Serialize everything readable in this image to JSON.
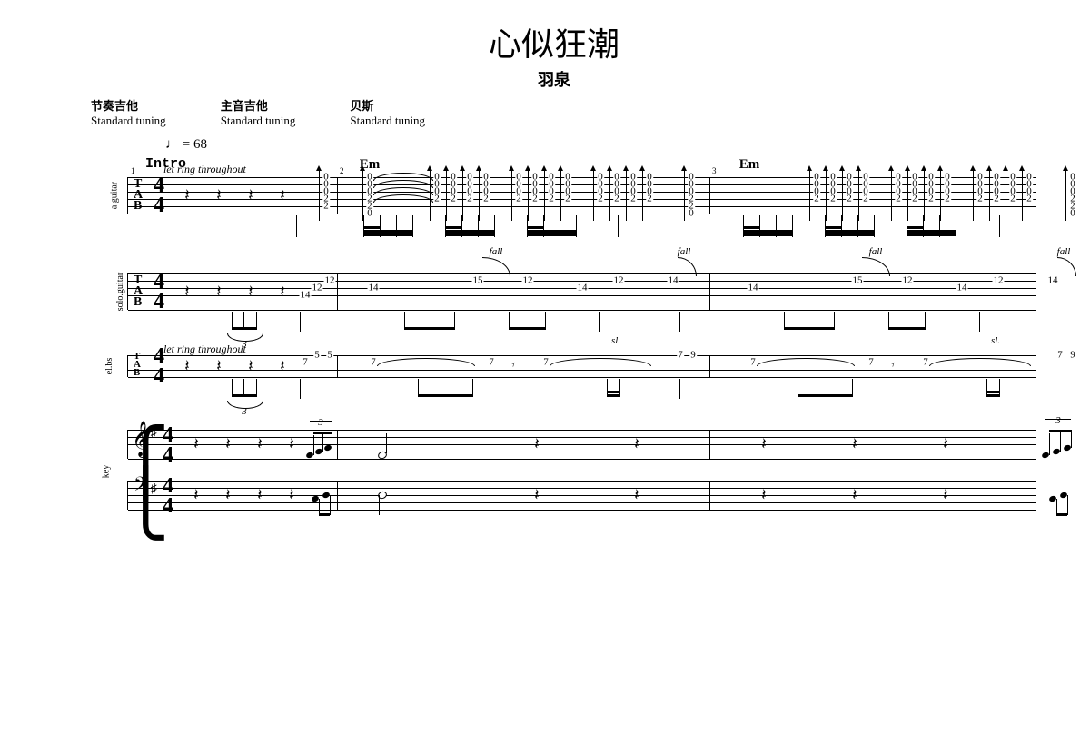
{
  "title": "心似狂潮",
  "artist": "羽泉",
  "instruments": [
    {
      "cn": "节奏吉他",
      "en": "Standard tuning"
    },
    {
      "cn": "主音吉他",
      "en": "Standard tuning"
    },
    {
      "cn": "贝斯",
      "en": "Standard tuning"
    }
  ],
  "tempo_note": "♩",
  "tempo_text": " = 68",
  "section": "Intro",
  "time_signature": {
    "num": "4",
    "den": "4"
  },
  "directions": {
    "let_ring": "let ring throughout",
    "fall": "fall",
    "slide": "sl."
  },
  "chords": {
    "Em": "Em"
  },
  "staff_labels": {
    "rhythm_guitar": "a.guitar",
    "solo_guitar": "solo.guitar",
    "bass": "el.bs",
    "keys": "key"
  },
  "tab_clef": [
    "T",
    "A",
    "B"
  ],
  "bar_numbers": [
    "1",
    "2",
    "3"
  ],
  "tuplet": "3",
  "chart_data": {
    "type": "guitar_tablature_score",
    "tempo_bpm": 68,
    "time_signature": "4/4",
    "key_signature": "G major / E minor (one sharp)",
    "measures_shown": 3,
    "tracks": [
      {
        "name": "a.guitar (rhythm)",
        "tuning": "Standard",
        "direction": "let ring throughout",
        "bars": [
          {
            "bar": 1,
            "events": [
              {
                "type": "rest",
                "dur": "q",
                "count": 4
              },
              {
                "type": "pickup",
                "notes": [
                  {
                    "string": 4,
                    "fret": 2
                  },
                  {
                    "string": 3,
                    "fret": 2
                  },
                  {
                    "string": 2,
                    "fret": 0
                  },
                  {
                    "string": 1,
                    "fret": 0
                  }
                ]
              }
            ]
          },
          {
            "bar": 2,
            "chord": "Em",
            "events": [
              {
                "type": "strum",
                "dir": "down",
                "beat": 1,
                "frets": [
                  0,
                  0,
                  0,
                  2,
                  2,
                  0
                ],
                "tied_to_next": true
              },
              {
                "type": "strum_group",
                "pattern": "dudu dudu dudu",
                "frets": [
                  0,
                  0,
                  0,
                  2,
                  "",
                  ""
                ]
              },
              {
                "type": "strum",
                "dir": "up",
                "beat": 4.75,
                "frets": [
                  0,
                  0,
                  0,
                  2,
                  2,
                  0
                ]
              }
            ]
          },
          {
            "bar": 3,
            "chord": "Em",
            "events": [
              {
                "type": "strum",
                "dir": "down",
                "beat": 1,
                "frets": [
                  0,
                  0,
                  0,
                  2,
                  2,
                  0
                ]
              },
              {
                "type": "strum_group",
                "pattern": "same as bar 2"
              },
              {
                "type": "strum",
                "dir": "up",
                "beat": 4.75,
                "frets": [
                  0,
                  0,
                  0,
                  2,
                  2,
                  0
                ]
              }
            ]
          }
        ]
      },
      {
        "name": "solo.guitar",
        "tuning": "Standard",
        "bars": [
          {
            "bar": 1,
            "events": [
              {
                "type": "rest",
                "dur": "q",
                "count": 4
              },
              {
                "type": "pickup_triplet",
                "notes": [
                  {
                    "s": 4,
                    "f": 14
                  },
                  {
                    "s": 3,
                    "f": 12
                  },
                  {
                    "s": 2,
                    "f": 12
                  }
                ]
              }
            ]
          },
          {
            "bar": 2,
            "events": [
              {
                "beat": 1,
                "s": 3,
                "f": 14
              },
              {
                "beat": 2,
                "s": 2,
                "f": 15,
                "artic": "fall",
                "to": {
                  "s": 2,
                  "f": 12
                }
              },
              {
                "beat": 3,
                "s": 3,
                "f": 14
              },
              {
                "beat": 3.5,
                "s": 2,
                "f": 12
              },
              {
                "beat": 4,
                "s": 2,
                "f": 14,
                "artic": "fall"
              }
            ]
          },
          {
            "bar": 3,
            "events": [
              {
                "beat": 1,
                "s": 3,
                "f": 14
              },
              {
                "beat": 2,
                "s": 2,
                "f": 15,
                "artic": "fall",
                "to": {
                  "s": 2,
                  "f": 12
                }
              },
              {
                "beat": 3,
                "s": 3,
                "f": 14
              },
              {
                "beat": 3.5,
                "s": 2,
                "f": 12
              },
              {
                "beat": 4,
                "s": 2,
                "f": 14,
                "artic": "fall"
              }
            ]
          }
        ]
      },
      {
        "name": "el.bs (bass)",
        "tuning": "Standard",
        "direction": "let ring throughout",
        "bars": [
          {
            "bar": 1,
            "events": [
              {
                "type": "rest",
                "dur": "q",
                "count": 4
              },
              {
                "type": "pickup_triplet",
                "notes": [
                  {
                    "s": 2,
                    "f": 7
                  },
                  {
                    "s": 1,
                    "f": 5
                  },
                  {
                    "s": 1,
                    "f": 5
                  }
                ]
              }
            ]
          },
          {
            "bar": 2,
            "events": [
              {
                "beat": 1,
                "s": 2,
                "f": 7,
                "tie": true
              },
              {
                "beat": 2.5,
                "s": 2,
                "f": 7
              },
              {
                "beat": 2.75,
                "type": "rest",
                "dur": "8"
              },
              {
                "beat": 3,
                "s": 2,
                "f": 7,
                "tie": true
              },
              {
                "beat": 4.5,
                "s": 1,
                "f": 7,
                "artic": "sl."
              },
              {
                "beat": 4.75,
                "s": 1,
                "f": 9
              }
            ]
          },
          {
            "bar": 3,
            "events": [
              {
                "beat": 1,
                "s": 2,
                "f": 7,
                "tie": true
              },
              {
                "beat": 2.5,
                "s": 2,
                "f": 7
              },
              {
                "beat": 2.75,
                "type": "rest",
                "dur": "8"
              },
              {
                "beat": 3,
                "s": 2,
                "f": 7,
                "tie": true
              },
              {
                "beat": 4.5,
                "s": 1,
                "f": 7,
                "artic": "sl."
              },
              {
                "beat": 4.75,
                "s": 1,
                "f": 9
              }
            ]
          }
        ]
      },
      {
        "name": "key (piano)",
        "staves": [
          "treble",
          "bass"
        ],
        "key_signature_sharps": 1,
        "bars": [
          {
            "bar": 1,
            "treble": [
              {
                "type": "rest",
                "dur": "q",
                "count": 4
              },
              {
                "type": "triplet",
                "notes": 3
              }
            ],
            "bass": [
              {
                "type": "rest",
                "dur": "q",
                "count": 4
              },
              {
                "type": "pickup",
                "notes": 2
              }
            ]
          },
          {
            "bar": 2,
            "treble": [
              {
                "type": "half"
              },
              {
                "type": "rest",
                "dur": "q"
              },
              {
                "type": "rest",
                "dur": "q"
              }
            ],
            "bass": [
              {
                "type": "half"
              },
              {
                "type": "rest",
                "dur": "q"
              },
              {
                "type": "rest",
                "dur": "q"
              }
            ]
          },
          {
            "bar": 3,
            "treble": [
              {
                "type": "rest",
                "dur": "q"
              },
              {
                "type": "rest",
                "dur": "q"
              },
              {
                "type": "rest",
                "dur": "q"
              },
              {
                "type": "triplet",
                "notes": 3
              }
            ],
            "bass": [
              {
                "type": "rest",
                "dur": "q"
              },
              {
                "type": "rest",
                "dur": "q"
              },
              {
                "type": "rest",
                "dur": "q"
              },
              {
                "type": "pickup",
                "notes": 2
              }
            ]
          }
        ]
      }
    ]
  }
}
